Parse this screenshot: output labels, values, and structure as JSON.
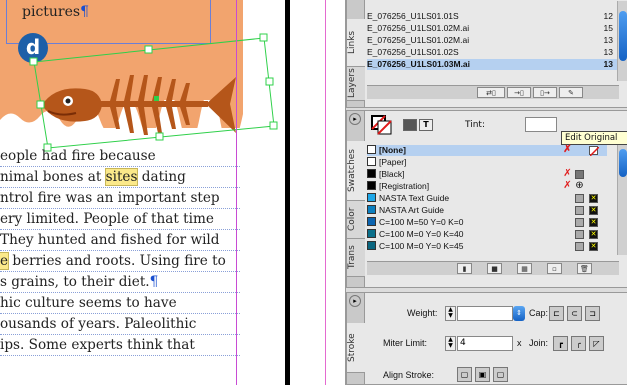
{
  "document": {
    "caption_text": "pictures",
    "caption_pilcrow": "¶",
    "badge_letter": "d",
    "body_lines": [
      {
        "pre": "eople had fire because",
        "hl": "",
        "post": ""
      },
      {
        "pre": "nimal bones at ",
        "hl": "sites",
        "post": " dating"
      },
      {
        "pre": "ntrol fire was an important step",
        "hl": "",
        "post": ""
      },
      {
        "pre": "ery limited. People of that time",
        "hl": "",
        "post": ""
      },
      {
        "pre": "They hunted and fished for wild",
        "hl": "",
        "post": ""
      },
      {
        "pre": "",
        "hl": "e",
        "post": " berries and roots. Using fire to"
      },
      {
        "pre": "s grains, to their diet.",
        "hl": "",
        "post": "",
        "pilcrow": "¶"
      },
      {
        "pre": "hic culture seems to have",
        "hl": "",
        "post": ""
      },
      {
        "pre": "ousands of years. Paleolithic",
        "hl": "",
        "post": ""
      },
      {
        "pre": "ips. Some experts think that",
        "hl": "",
        "post": ""
      }
    ]
  },
  "links_panel": {
    "tabs": [
      "Links",
      "Layers"
    ],
    "rows": [
      {
        "name": "E_076256_U1LS01.01S",
        "page": "12"
      },
      {
        "name": "E_076256_U1LS01.02M.ai",
        "page": "15"
      },
      {
        "name": "E_076256_U1LS01.02M.ai",
        "page": "13"
      },
      {
        "name": "E_076256_U1LS01.02S",
        "page": "13"
      },
      {
        "name": "E_076256_U1LS01.03M.ai",
        "page": "13",
        "selected": true
      }
    ],
    "toolbar": [
      "relink",
      "goto-link",
      "update-link",
      "edit-original"
    ]
  },
  "swatches_panel": {
    "tabs": [
      "Swatches",
      "Color",
      "Trans"
    ],
    "tint_label": "Tint:",
    "tint_value": "",
    "tooltip": "Edit Original",
    "rows": [
      {
        "name": "[None]",
        "color": "#ffffff",
        "selected": true
      },
      {
        "name": "[Paper]",
        "color": "#ffffff"
      },
      {
        "name": "[Black]",
        "color": "#000000"
      },
      {
        "name": "[Registration]",
        "color": "#000000"
      },
      {
        "name": "NASTA Text Guide",
        "color": "#1ea7e8"
      },
      {
        "name": "NASTA Art Guide",
        "color": "#0b7fc0"
      },
      {
        "name": "C=100 M=50 Y=0 K=0",
        "color": "#0b64b0"
      },
      {
        "name": "C=100 M=0 Y=0 K=40",
        "color": "#0a6f8a"
      },
      {
        "name": "C=100 M=0 Y=0 K=45",
        "color": "#0a6680"
      }
    ]
  },
  "stroke_panel": {
    "tab": "Stroke",
    "weight_label": "Weight:",
    "weight_value": "",
    "cap_label": "Cap:",
    "miter_label": "Miter Limit:",
    "miter_value": "4",
    "x_label": "x",
    "join_label": "Join:",
    "align_label": "Align Stroke:"
  },
  "colors": {
    "accent_blue": "#1562c4",
    "selection_green": "#2fd04a",
    "orange_art": "#f2a46e",
    "highlight": "#fbe98a",
    "frame_green": "#9fc27c"
  }
}
